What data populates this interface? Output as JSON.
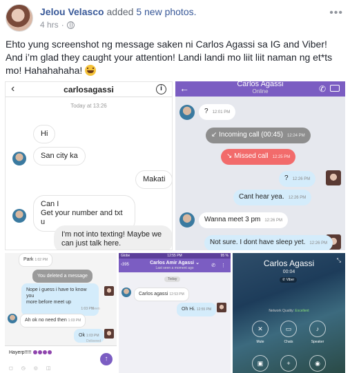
{
  "post": {
    "author": "Jelou Velasco",
    "action": "added",
    "count_text": "5 new photos.",
    "time": "4 hrs",
    "separator": "·",
    "more": "•••",
    "text": "Ehto yung screenshot ng message saken ni Carlos Agassi sa IG and Viber! And i’m glad they caught your attention! Landi landi mo liit liit naman ng et*ts mo! Hahahahaha!"
  },
  "photo1": {
    "back": "‹",
    "title": "carlosagassi",
    "info": "i",
    "date": "Today at 13:26",
    "messages": [
      "Hi",
      "San city ka",
      "Makati",
      "Can I",
      "Get your number and txt u",
      "I'm not into texting! Maybe we",
      "can just talk here."
    ]
  },
  "photo2": {
    "back": "←",
    "name": "Carlos Agassi",
    "status": "Online",
    "call_icon": "✆",
    "messages": [
      {
        "text": "?",
        "time": "12:01 PM"
      },
      {
        "text": "↙ Incoming call (00:45)",
        "time": "12:24 PM"
      },
      {
        "text": "↘ Missed call",
        "time": "12:25 PM"
      },
      {
        "text": "?",
        "time": "12:26 PM"
      },
      {
        "text": "Cant hear yea.",
        "time": "12:26 PM"
      },
      {
        "text": "Wanna meet 3 pm",
        "time": "12:26 PM"
      },
      {
        "text": "Not sure. I dont have sleep yet.",
        "time": "12:26 PM"
      }
    ]
  },
  "photo3": {
    "top_text": "Park",
    "top_time": "1:02 PM",
    "deleted": "You deleted a message",
    "m1": "Nope i guess i have to know you",
    "m1b": "more before meet up",
    "m1_time": "1:03 PM",
    "seen": "Seen",
    "m2": "Ah ok no need then",
    "m2_time": "1:03 PM",
    "m3": "Ok",
    "m3_time": "1:03 PM",
    "delivered": "Delivered",
    "input": "Hayerp!!!!!",
    "send": "↑",
    "icons": "◻ ◷ ◎ ◫"
  },
  "photo4": {
    "status_left": "Globe",
    "status_time": "12:55 PM",
    "status_right": "95 %",
    "back": "‹395",
    "name": "Carlos Amir Agassi ⌄",
    "sub": "Last seen a moment ago",
    "icons": "✆ ⋮",
    "today": "Today",
    "m1": "Carlos agassi",
    "m1_time": "12:53 PM",
    "m2": "Oh Hi.",
    "m2_time": "12:55 PM"
  },
  "photo5": {
    "name": "Carlos Agassi",
    "time": "00:04",
    "badge": "✆ Viber",
    "quality_label": "Network Quality:",
    "quality_value": "Excellent",
    "minimize": "⤡",
    "mute": "Mute",
    "chats": "Chats",
    "speaker": "Speaker"
  }
}
